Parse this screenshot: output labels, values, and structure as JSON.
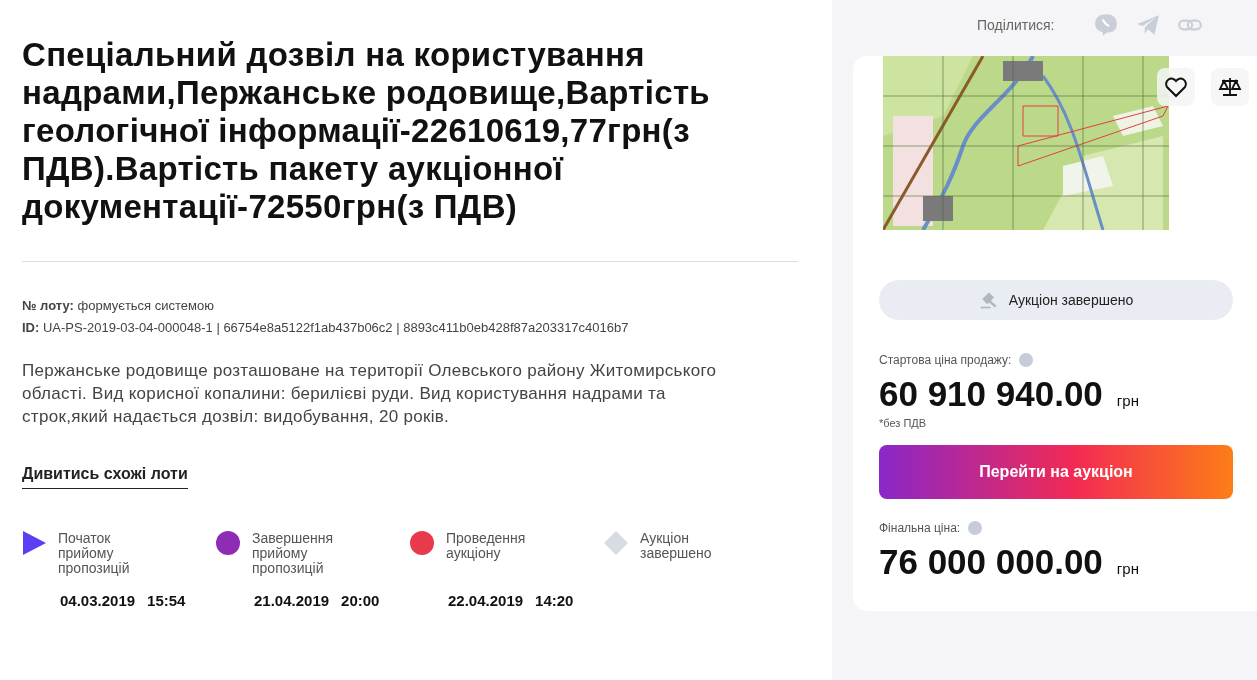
{
  "title": "Спеціальний дозвіл на користування надрами,Пержанське родовище,Вартість геологічної інформації-22610619,77грн(з ПДВ).Вартість пакету аукціонної документації-72550грн(з ПДВ)",
  "lot": {
    "label": "№ лоту:",
    "value": "формується системою"
  },
  "id": {
    "label": "ID:",
    "value": "UA-PS-2019-03-04-000048-1 | 66754e8a5122f1ab437b06c2 | 8893c411b0eb428f87a203317c4016b7"
  },
  "description": "Пержанське родовище розташоване на території Олевського району Житомирського області. Вид корисної копалини: берилієві руди. Вид користування надрами та строк,який надається дозвіл: видобування, 20 років.",
  "similar_link": "Дивитись схожі лоти",
  "timeline": [
    {
      "kind": "triangle",
      "color": "#5b3ff5",
      "label": "Початок прийому пропозицій",
      "date": "04.03.2019",
      "time": "15:54"
    },
    {
      "kind": "circle",
      "color": "#8e2cb5",
      "label": "Завершення прийому пропозицій",
      "date": "21.04.2019",
      "time": "20:00"
    },
    {
      "kind": "circle",
      "color": "#e83a4a",
      "label": "Проведення аукціону",
      "date": "22.04.2019",
      "time": "14:20"
    },
    {
      "kind": "diamond",
      "color": "#d8dbe2",
      "label": "Аукціон завершено"
    }
  ],
  "share": {
    "label": "Поділитися:"
  },
  "card": {
    "status": "Аукціон завершено",
    "start_price": {
      "label": "Стартова ціна продажу:",
      "amount": "60 910 940.00",
      "currency": "грн",
      "note": "*без ПДВ"
    },
    "button": "Перейти на аукціон",
    "final_price": {
      "label": "Фінальна ціна:",
      "amount": "76 000 000.00",
      "currency": "грн"
    }
  }
}
